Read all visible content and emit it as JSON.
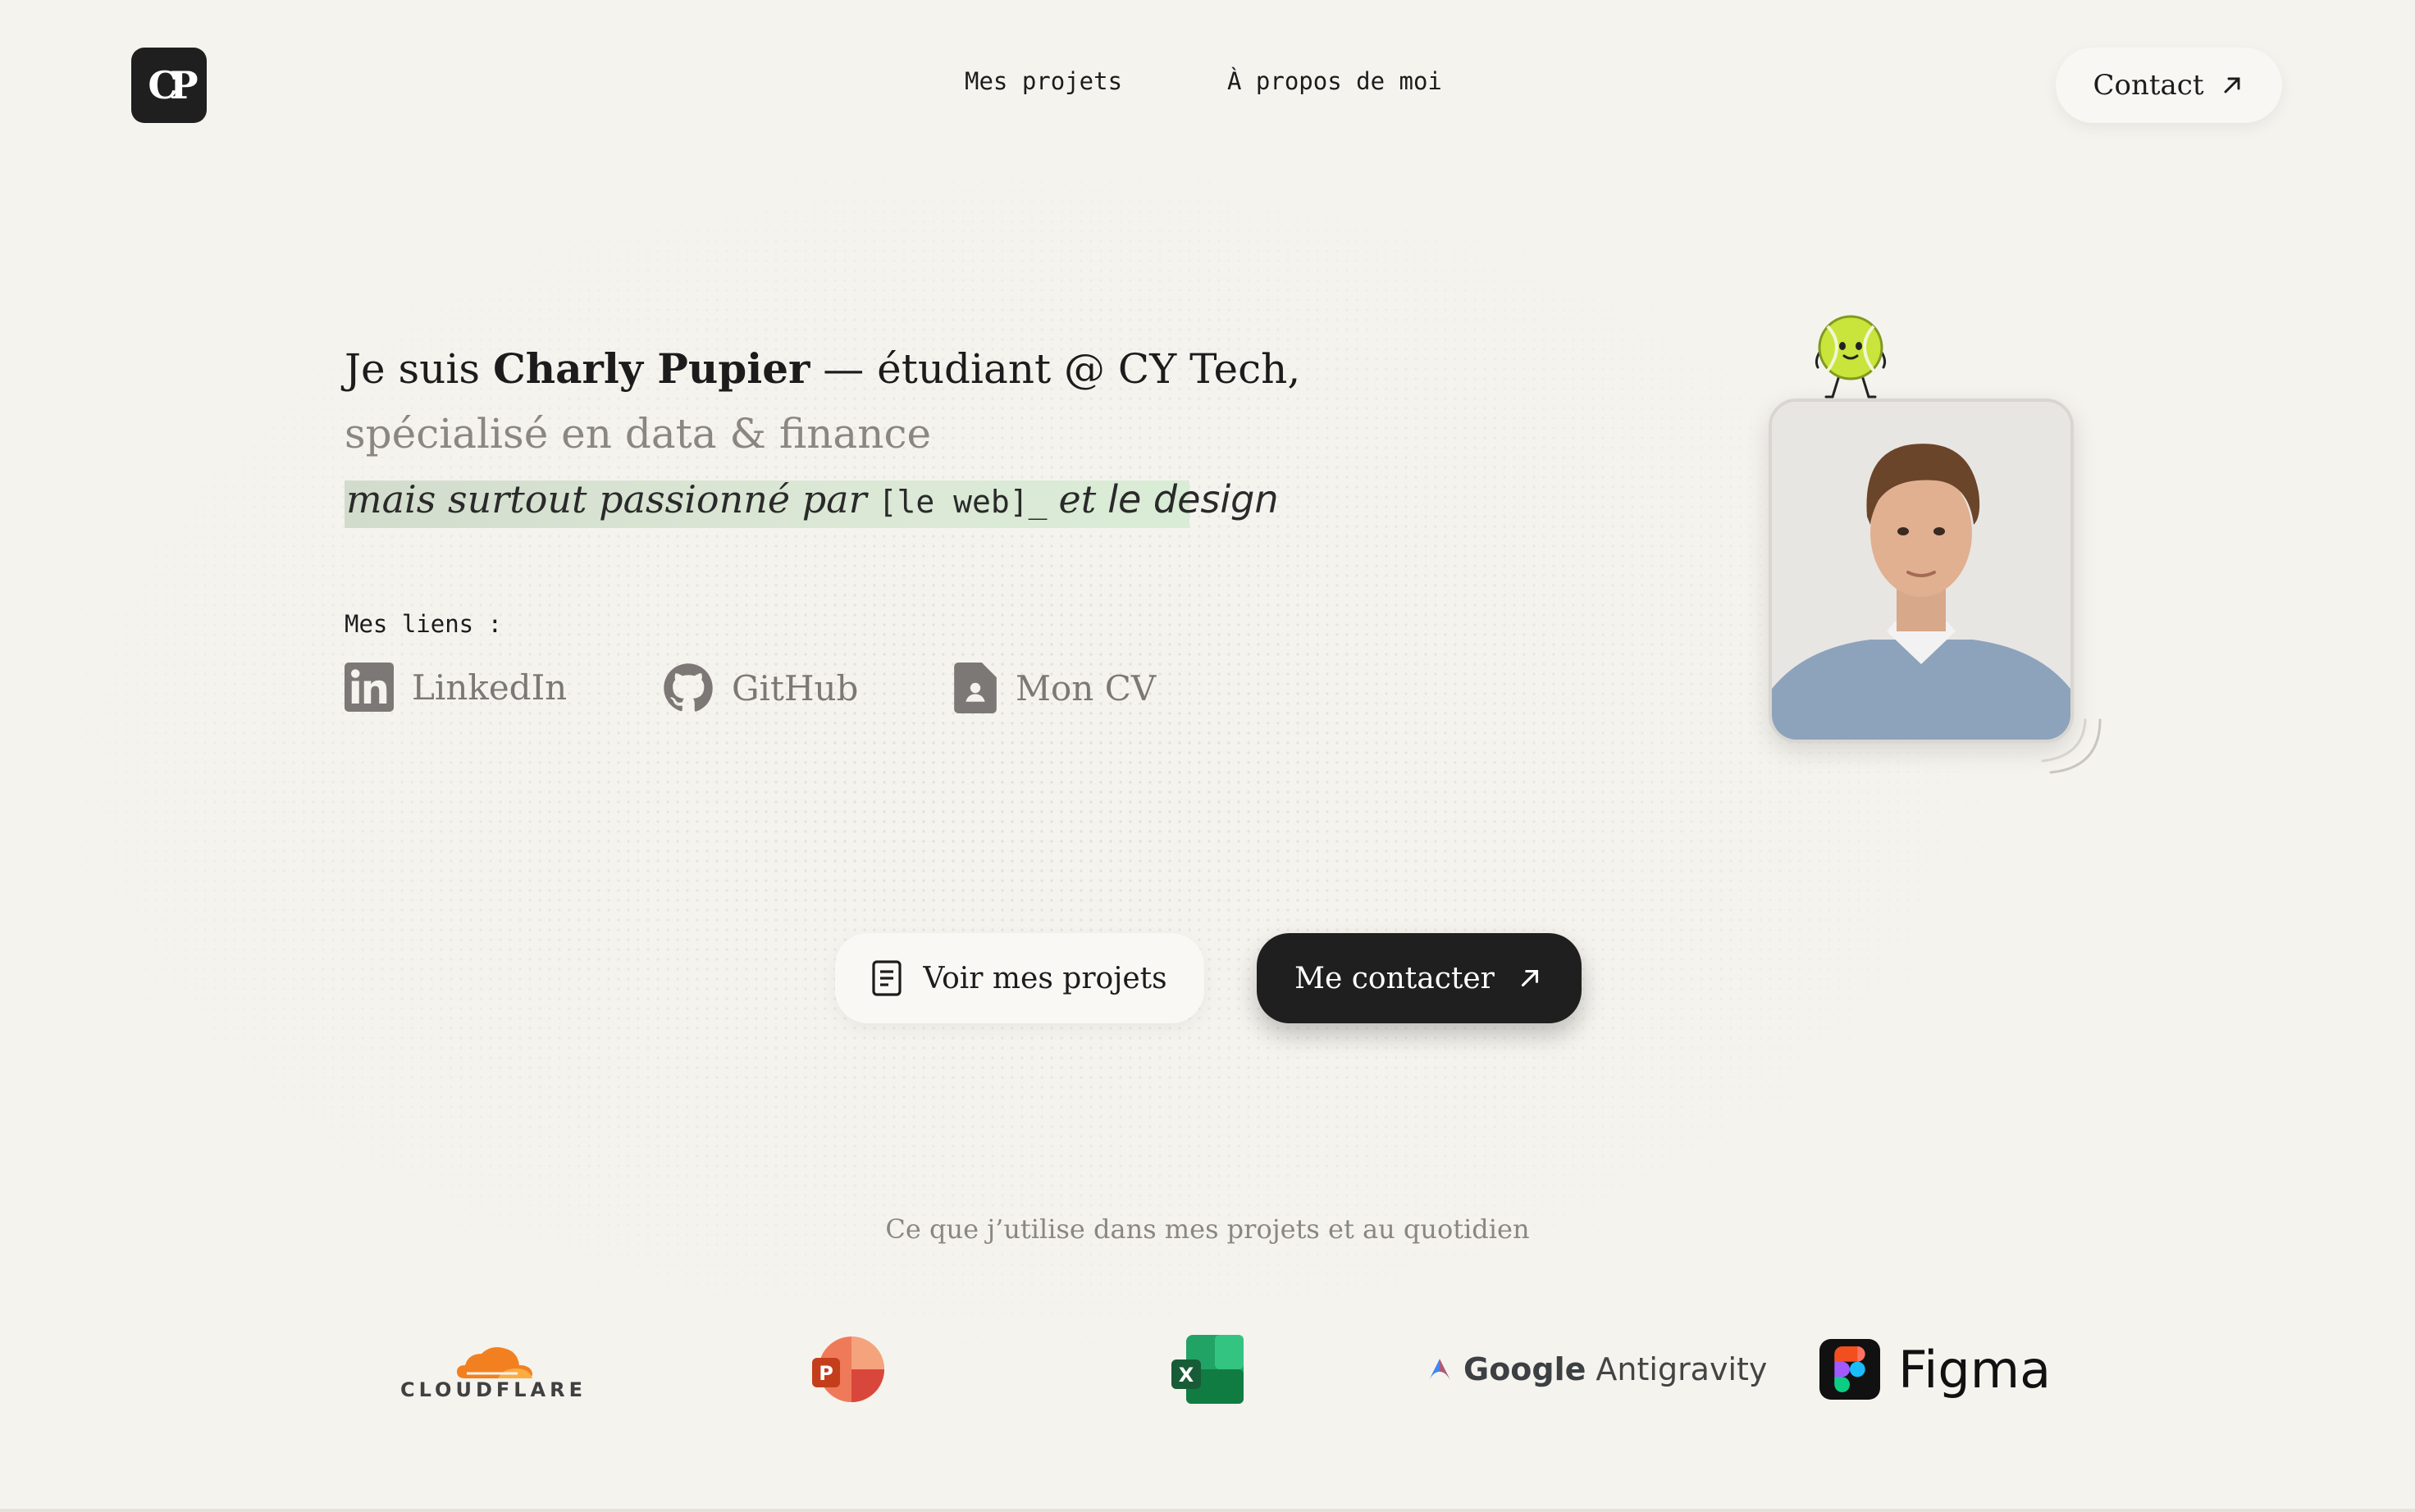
{
  "header": {
    "logo_text": "CP",
    "nav": [
      "Mes projets",
      "À propos de moi"
    ],
    "contact_label": "Contact"
  },
  "hero": {
    "intro_prefix": "Je suis",
    "name": "Charly Pupier",
    "intro_suffix": "— étudiant @ CY Tech,",
    "specialty": "spécialisé en data & finance",
    "passion_prefix": "mais surtout passionné par",
    "passion_web": "[le web]_",
    "passion_et": "et",
    "passion_design": "le design",
    "highlight_color": "#d6e6d1"
  },
  "links": {
    "title": "Mes liens :",
    "items": [
      {
        "label": "LinkedIn",
        "icon": "linkedin-icon"
      },
      {
        "label": "GitHub",
        "icon": "github-icon"
      },
      {
        "label": "Mon CV",
        "icon": "cv-document-icon"
      }
    ]
  },
  "cta": {
    "projects_label": "Voir mes projets",
    "contact_label": "Me contacter"
  },
  "tools": {
    "caption": "Ce que j’utilise dans mes projets et au quotidien",
    "cloudflare": "CLOUDFLARE",
    "google_antigravity_g": "Google",
    "google_antigravity_name": "Antigravity",
    "figma": "Figma",
    "icons": [
      "cloudflare-logo",
      "powerpoint-icon",
      "excel-icon",
      "google-antigravity-logo",
      "figma-logo"
    ]
  },
  "colors": {
    "background": "#f5f3ee",
    "dark": "#1f1f1f",
    "muted": "#8a8783",
    "cloudflare_orange": "#f38020"
  }
}
